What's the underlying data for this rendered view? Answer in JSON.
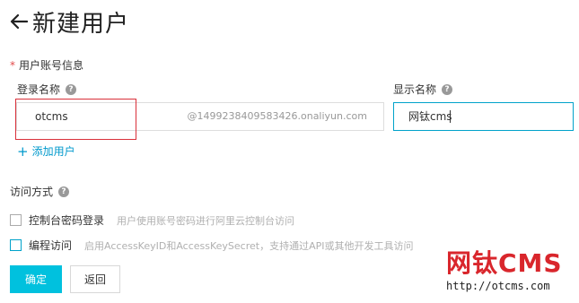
{
  "header": {
    "title": "新建用户",
    "back_icon": "arrow-left-icon"
  },
  "section": {
    "required_mark": "*",
    "label": "用户账号信息"
  },
  "login": {
    "label": "登录名称",
    "help": "?",
    "value": "otcms",
    "suffix": "@1499238409583426.onaliyun.com"
  },
  "display": {
    "label": "显示名称",
    "help": "?",
    "value": "网钛cms"
  },
  "add_user": {
    "plus": "+",
    "label": "添加用户"
  },
  "access": {
    "label": "访问方式",
    "help": "?",
    "options": [
      {
        "label": "控制台密码登录",
        "desc": "用户使用账号密码进行阿里云控制台访问"
      },
      {
        "label": "编程访问",
        "desc": "启用AccessKeyID和AccessKeySecret，支持通过API或其他开发工具访问"
      }
    ]
  },
  "buttons": {
    "ok": "确定",
    "back": "返回"
  },
  "watermark": {
    "title": "网钛CMS",
    "url": "http://otcms.com"
  },
  "colors": {
    "accent": "#00c1de",
    "link": "#0099cc",
    "required": "#e24b4b",
    "highlight": "#d9303a",
    "watermark": "#d9262c"
  }
}
